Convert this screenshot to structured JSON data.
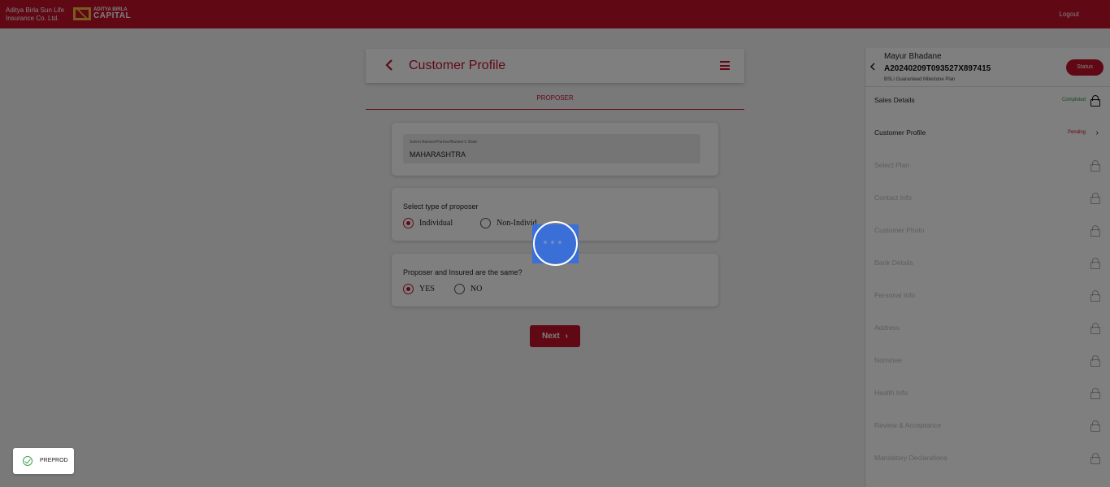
{
  "header": {
    "company_line1": "Aditya Birla Sun Life",
    "company_line2": "Insurance Co. Ltd.",
    "logo_small": "ADITYA BIRLA",
    "logo_big": "CAPITAL",
    "logout_label": "Logout",
    "brand_color": "#c2112a"
  },
  "main": {
    "title": "Customer Profile",
    "tab_label": "PROPOSER",
    "state_field": {
      "label": "Select Advisor/Partner/Banker's State",
      "value": "MAHARASHTRA"
    },
    "proposer_type": {
      "question": "Select type of proposer",
      "options": [
        "Individual",
        "Non-Individ"
      ],
      "selected": "Individual"
    },
    "same_insured": {
      "question": "Proposer and Insured are the same?",
      "options": [
        "YES",
        "NO"
      ],
      "selected": "YES"
    },
    "next_label": "Next",
    "next_icon": "chevron-right-icon"
  },
  "sidebar": {
    "customer_name": "Mayur Bhadane",
    "application_id": "A20240209T093527X897415",
    "plan_name": "BSLI Guaranteed Milestone Plan",
    "status_label": "Status",
    "items": [
      {
        "label": "Sales Details",
        "state": "Completed",
        "icon": "lock-icon"
      },
      {
        "label": "Customer Profile",
        "state": "Pending",
        "icon": "chevron-right-icon"
      },
      {
        "label": "Select Plan",
        "icon": "lock-icon"
      },
      {
        "label": "Contact Info",
        "icon": "lock-icon"
      },
      {
        "label": "Customer Photo",
        "icon": "lock-icon"
      },
      {
        "label": "Bank Details",
        "icon": "lock-icon"
      },
      {
        "label": "Personal Info",
        "icon": "lock-icon"
      },
      {
        "label": "Address",
        "icon": "lock-icon"
      },
      {
        "label": "Nominee",
        "icon": "lock-icon"
      },
      {
        "label": "Health Info",
        "icon": "lock-icon"
      },
      {
        "label": "Review & Acceptance",
        "icon": "lock-icon"
      },
      {
        "label": "Mandatory Declarations",
        "icon": "lock-icon"
      }
    ]
  },
  "loader": {
    "icon": "loading-spinner-icon"
  },
  "env_badge": {
    "label": "PREPROD",
    "icon": "check-circle-icon"
  }
}
